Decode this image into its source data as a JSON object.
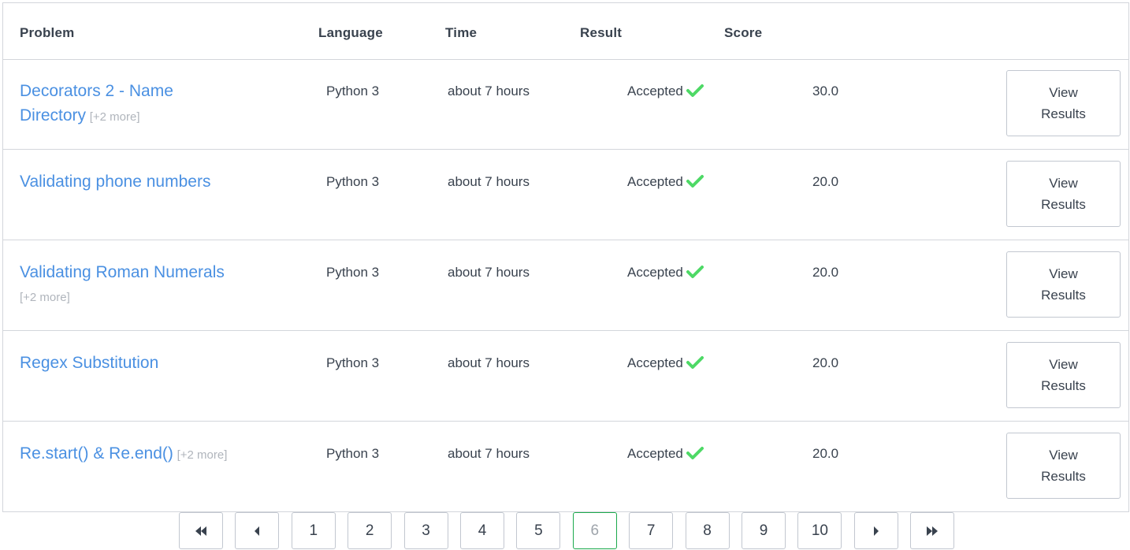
{
  "columns": {
    "problem": "Problem",
    "language": "Language",
    "time": "Time",
    "result": "Result",
    "score": "Score"
  },
  "rows": [
    {
      "problem": "Decorators 2 - Name Directory",
      "more": "[+2 more]",
      "language": "Python 3",
      "time": "about 7 hours",
      "result": "Accepted",
      "score": "30.0",
      "button": [
        "View",
        "Results"
      ]
    },
    {
      "problem": "Validating phone numbers",
      "more": "",
      "language": "Python 3",
      "time": "about 7 hours",
      "result": "Accepted",
      "score": "20.0",
      "button": [
        "View",
        "Results"
      ]
    },
    {
      "problem": "Validating Roman Numerals",
      "more": "[+2 more]",
      "language": "Python 3",
      "time": "about 7 hours",
      "result": "Accepted",
      "score": "20.0",
      "button": [
        "View",
        "Results"
      ]
    },
    {
      "problem": "Regex Substitution",
      "more": "",
      "language": "Python 3",
      "time": "about 7 hours",
      "result": "Accepted",
      "score": "20.0",
      "button": [
        "View",
        "Results"
      ]
    },
    {
      "problem": "Re.start() & Re.end()",
      "more": "[+2 more]",
      "language": "Python 3",
      "time": "about 7 hours",
      "result": "Accepted",
      "score": "20.0",
      "button": [
        "View",
        "Results"
      ]
    }
  ],
  "pagination": {
    "first_icon": "double-chevron-left-icon",
    "prev_icon": "caret-left-icon",
    "pages": [
      "1",
      "2",
      "3",
      "4",
      "5",
      "6",
      "7",
      "8",
      "9",
      "10"
    ],
    "current_page": "6",
    "next_icon": "caret-right-icon",
    "last_icon": "double-chevron-right-icon"
  },
  "colors": {
    "link": "#4a90e2",
    "accepted_check": "#4ed966",
    "active_page_border": "#1ba94c"
  }
}
